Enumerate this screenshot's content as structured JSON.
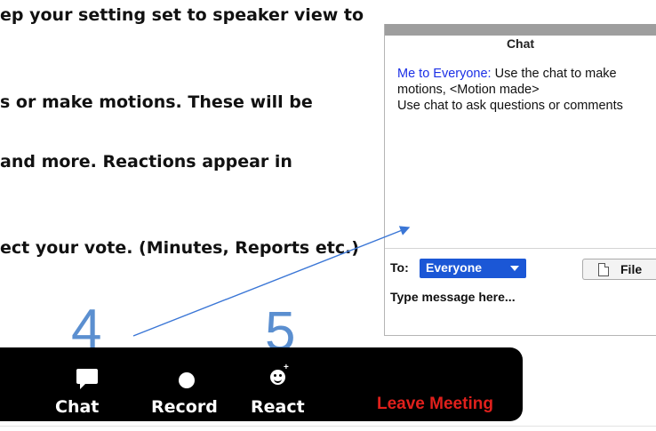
{
  "document": {
    "lines": [
      "ep your setting set to speaker view  to",
      "s or make motions.   These will be",
      " and more. Reactions appear in",
      "ect your vote. (Minutes, Reports etc.)"
    ]
  },
  "chat_panel": {
    "title": "Chat",
    "message_sender": "Me to Everyone:",
    "message_text": "  Use the chat to make motions, <Motion made>",
    "message_line2": "Use chat to ask questions or comments",
    "to_label": "To:",
    "recipient": "Everyone",
    "file_button": "File",
    "input_placeholder": "Type message here..."
  },
  "annotations": {
    "step_chat": "4",
    "step_react": "5",
    "annotation_color": "#5b8fd0"
  },
  "toolbar": {
    "chat_label": "Chat",
    "record_label": "Record",
    "react_label": "React",
    "leave_label": "Leave Meeting",
    "leave_color": "#e0201c",
    "icons": [
      "chat-bubble-icon",
      "record-icon",
      "react-emoji-icon"
    ]
  }
}
